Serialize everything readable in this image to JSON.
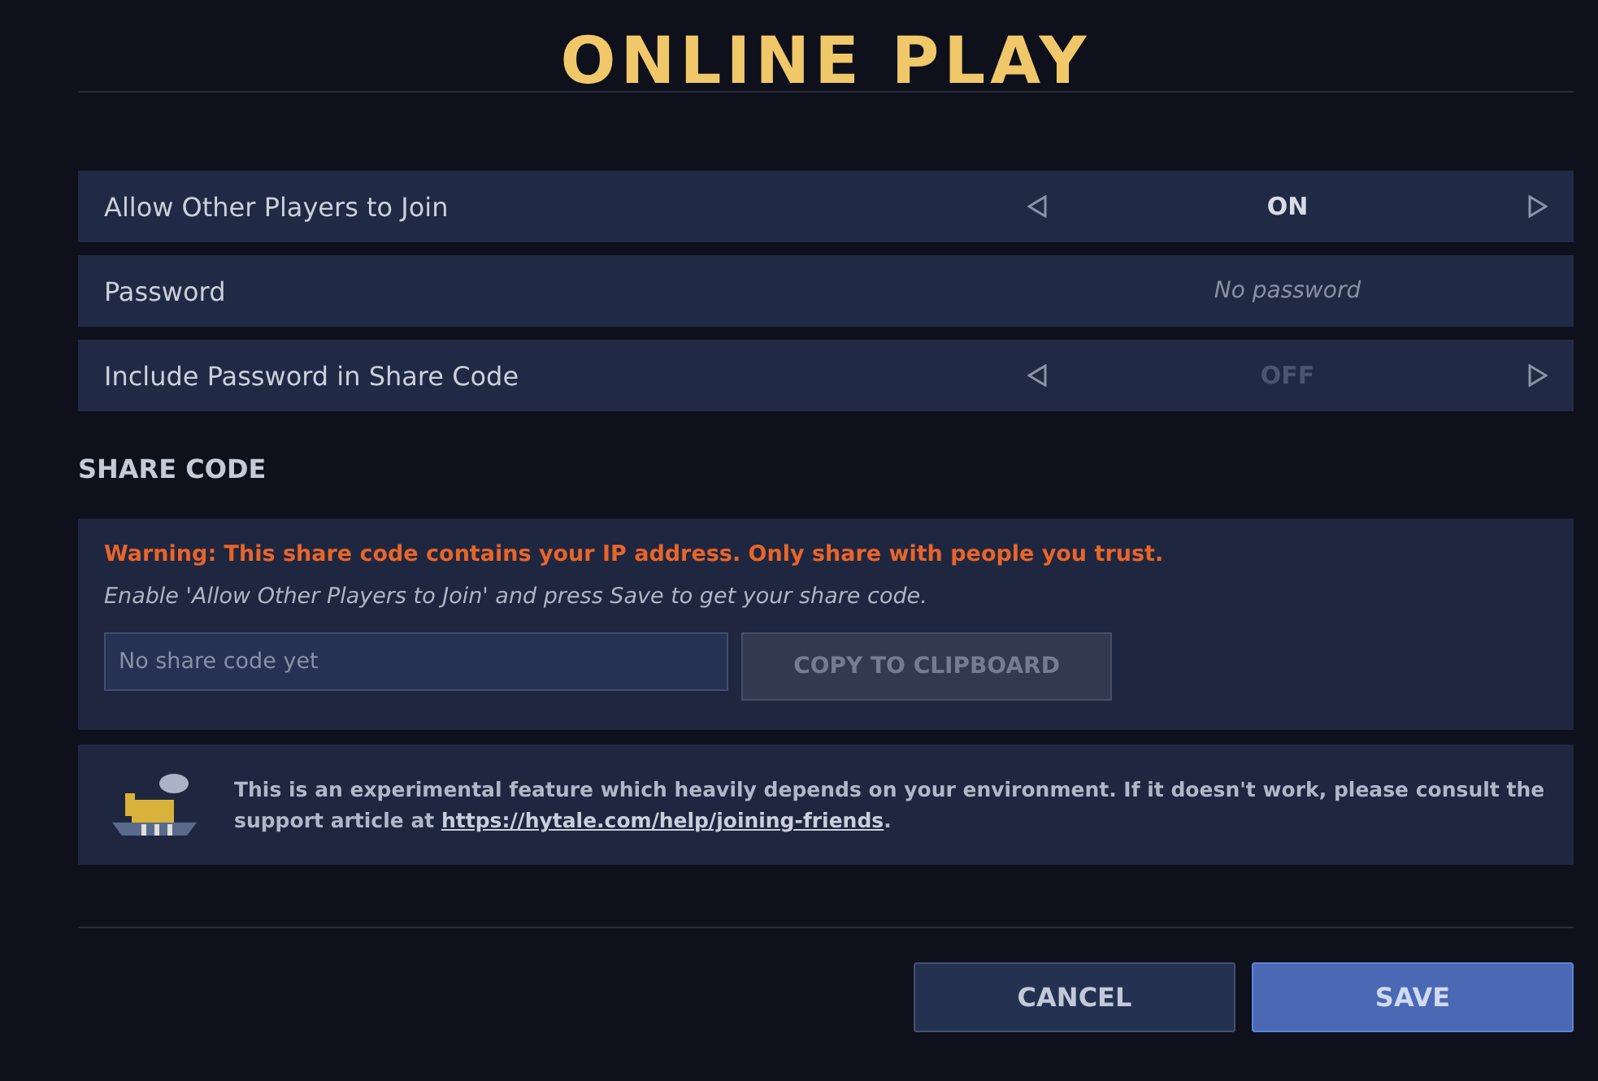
{
  "title": "ONLINE PLAY",
  "settings": [
    {
      "kind": "toggle",
      "label": "Allow Other Players to Join",
      "value": "ON",
      "on": true
    },
    {
      "kind": "text",
      "label": "Password",
      "value": "No password"
    },
    {
      "kind": "toggle",
      "label": "Include Password in Share Code",
      "value": "OFF",
      "on": false
    }
  ],
  "share_code": {
    "heading": "SHARE CODE",
    "warning": "Warning: This share code contains your IP address. Only share with people you trust.",
    "hint": "Enable 'Allow Other Players to Join' and press Save to get your share code.",
    "field": {
      "placeholder": "No share code yet"
    },
    "copy_button": {
      "label": "COPY TO CLIPBOARD",
      "disabled": true
    }
  },
  "notice": {
    "text_before": "This is an experimental feature which heavily depends on your environment. If it doesn't work, please consult the support article at ",
    "link": "https://hytale.com/help/joining-friends",
    "text_after": "."
  },
  "buttons": [
    {
      "kind": "secondary",
      "label": "CANCEL"
    },
    {
      "kind": "primary",
      "label": "SAVE"
    }
  ]
}
